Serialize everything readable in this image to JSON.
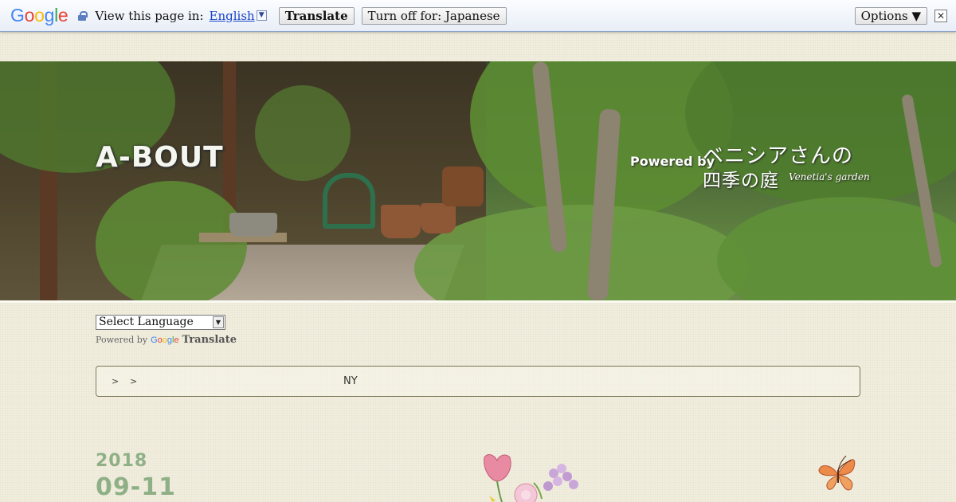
{
  "translate_bar": {
    "logo": {
      "g1": "G",
      "o1": "o",
      "o2": "o",
      "g2": "g",
      "l": "l",
      "e": "e"
    },
    "view_label": "View this page in:",
    "language": "English",
    "translate_button": "Translate",
    "turn_off_button": "Turn off for: Japanese",
    "options_button": "Options ▼",
    "close_glyph": "✕",
    "icons": [
      "lock-icon",
      "dropdown-arrow-icon",
      "close-icon"
    ]
  },
  "banner": {
    "site_title": "A-BOUT",
    "powered_by": "Powered by",
    "garden_line1": "ベニシアさんの",
    "garden_line2": "四季の庭",
    "garden_script": "Venetia's garden"
  },
  "language_widget": {
    "select_value": "Select Language",
    "powered_by": "Powered by",
    "google": {
      "g1": "G",
      "o1": "o",
      "o2": "o",
      "g2": "g",
      "l": "l",
      "e": "e"
    },
    "translate": "Translate"
  },
  "breadcrumb": {
    "separator1": ">",
    "separator2": ">",
    "current": "NY"
  },
  "post_date": {
    "year": "2018",
    "month_day": "09-11"
  },
  "colors": {
    "accent_green": "#8fb087",
    "link_blue": "#1a44c7",
    "background": "#f1eedf"
  }
}
